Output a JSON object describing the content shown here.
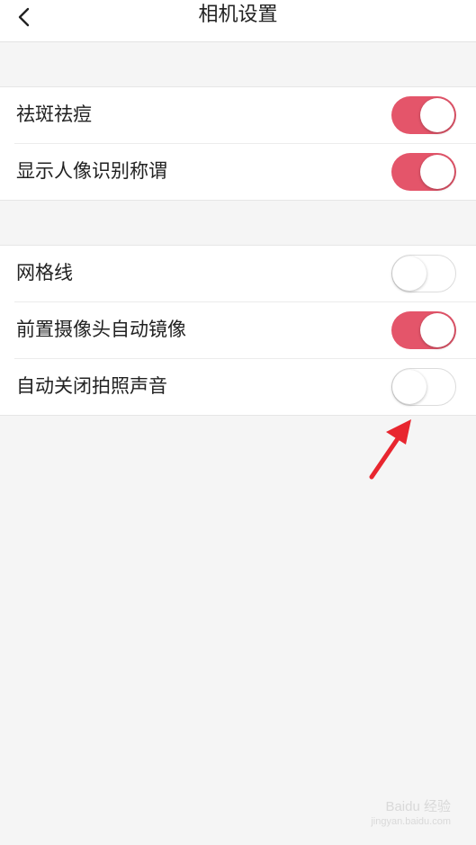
{
  "header": {
    "title": "相机设置"
  },
  "group1": {
    "items": [
      {
        "label": "祛斑祛痘",
        "enabled": true
      },
      {
        "label": "显示人像识别称谓",
        "enabled": true
      }
    ]
  },
  "group2": {
    "items": [
      {
        "label": "网格线",
        "enabled": false
      },
      {
        "label": "前置摄像头自动镜像",
        "enabled": true
      },
      {
        "label": "自动关闭拍照声音",
        "enabled": false
      }
    ]
  },
  "colors": {
    "accent": "#e4556a",
    "background": "#f5f5f5",
    "annotation_arrow": "#e8262f"
  },
  "icons": {
    "back": "chevron-left-icon",
    "annotation": "arrow-icon"
  },
  "watermark": {
    "line1": "Baidu 经验",
    "line2": "jingyan.baidu.com"
  }
}
